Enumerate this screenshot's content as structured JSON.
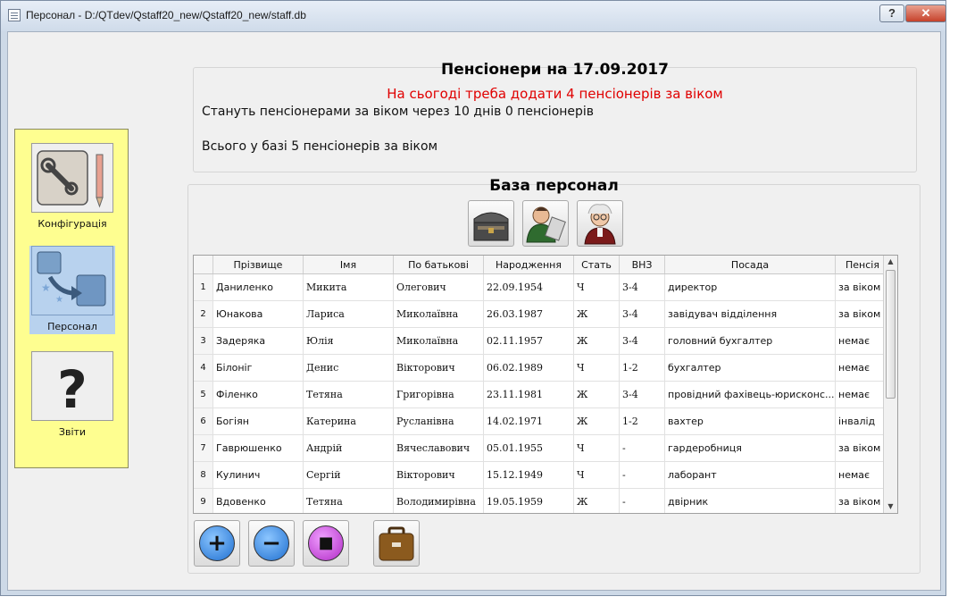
{
  "window": {
    "title": "Персонал - D:/QTdev/Qstaff20_new/Qstaff20_new/staff.db",
    "help_label": "?",
    "close_label": "✕"
  },
  "sidebar": {
    "items": [
      {
        "label": "Конфігурація",
        "icon": "config-tools-icon"
      },
      {
        "label": "Персонал",
        "icon": "personnel-icon",
        "active": true
      },
      {
        "label": "Звіти",
        "icon": "reports-question-icon"
      }
    ]
  },
  "pensioners": {
    "title": "Пенсіонери на 17.09.2017",
    "need_to_add": "На сьогоді треба додати   4 пенсіонерів за віком",
    "upcoming": "Стануть пенсіонерами за віком через 10 днів  0 пенсіонерів",
    "total": "Всього у базі 5 пенсіонерів за віком"
  },
  "database": {
    "title": "База персонал",
    "toolbar_icons": [
      "archive-chest-icon",
      "employees-icon",
      "pensioner-icon"
    ],
    "columns": [
      "Прізвище",
      "Імя",
      "По батькові",
      "Народження",
      "Стать",
      "ВНЗ",
      "Посада",
      "Пенсія"
    ],
    "rows": [
      {
        "n": "1",
        "surname": "Даниленко",
        "name": "Микита",
        "patronymic": "Олегович",
        "birth": "22.09.1954",
        "sex": "Ч",
        "vnz": "3-4",
        "position": "директор",
        "pension": "за віком"
      },
      {
        "n": "2",
        "surname": "Юнакова",
        "name": "Лариса",
        "patronymic": "Миколаївна",
        "birth": "26.03.1987",
        "sex": "Ж",
        "vnz": "3-4",
        "position": "завідувач відділення",
        "pension": "за віком"
      },
      {
        "n": "3",
        "surname": "Задеряка",
        "name": "Юлія",
        "patronymic": "Миколаївна",
        "birth": "02.11.1957",
        "sex": "Ж",
        "vnz": "3-4",
        "position": "головний бухгалтер",
        "pension": "немає"
      },
      {
        "n": "4",
        "surname": "Білоніг",
        "name": "Денис",
        "patronymic": "Вікторович",
        "birth": "06.02.1989",
        "sex": "Ч",
        "vnz": "1-2",
        "position": "бухгалтер",
        "pension": "немає"
      },
      {
        "n": "5",
        "surname": "Філенко",
        "name": "Тетяна",
        "patronymic": "Григорівна",
        "birth": "23.11.1981",
        "sex": "Ж",
        "vnz": "3-4",
        "position": "провідний фахівець-юрисконс...",
        "pension": "немає"
      },
      {
        "n": "6",
        "surname": "Богіян",
        "name": "Катерина",
        "patronymic": "Русланівна",
        "birth": "14.02.1971",
        "sex": "Ж",
        "vnz": "1-2",
        "position": "вахтер",
        "pension": "інвалід"
      },
      {
        "n": "7",
        "surname": "Гаврюшенко",
        "name": "Андрій",
        "patronymic": "Вячеславович",
        "birth": "05.01.1955",
        "sex": "Ч",
        "vnz": "-",
        "position": "гардеробниця",
        "pension": "за віком"
      },
      {
        "n": "8",
        "surname": "Кулинич",
        "name": "Сергій",
        "patronymic": "Вікторович",
        "birth": "15.12.1949",
        "sex": "Ч",
        "vnz": "-",
        "position": "лаборант",
        "pension": "немає"
      },
      {
        "n": "9",
        "surname": "Вдовенко",
        "name": "Тетяна",
        "patronymic": "Володимирівна",
        "birth": "19.05.1959",
        "sex": "Ж",
        "vnz": "-",
        "position": "двірник",
        "pension": "за віком"
      }
    ]
  },
  "actions": {
    "add_label": "+",
    "remove_label": "−",
    "stop_label": "■",
    "icons": [
      "add-icon",
      "remove-icon",
      "stop-icon",
      "briefcase-icon"
    ],
    "colors": {
      "add": "#3a8ee6",
      "remove": "#3a8ee6",
      "stop": "#c742d8"
    }
  }
}
